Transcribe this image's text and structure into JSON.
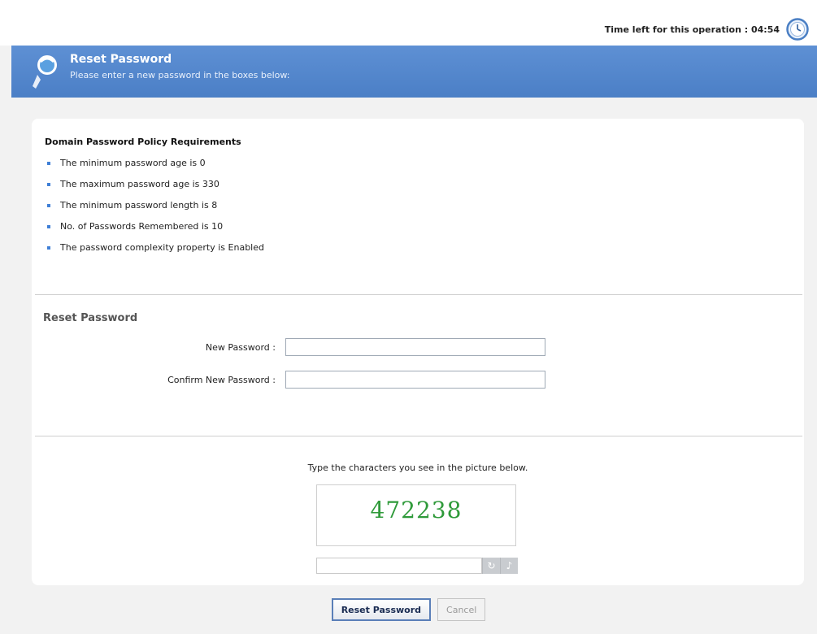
{
  "header": {
    "timer_label": "Time left for this operation :",
    "timer_value": "04:54"
  },
  "banner": {
    "title": "Reset Password",
    "subtitle": "Please enter a new password in the boxes below:"
  },
  "policy": {
    "title": "Domain Password Policy Requirements",
    "items": [
      "The minimum password age is 0",
      "The maximum password age is 330",
      "The minimum password length is 8",
      "No. of Passwords Remembered is 10",
      "The password complexity property is Enabled"
    ]
  },
  "reset_form": {
    "section_title": "Reset Password",
    "new_password_label": "New Password :",
    "new_password_value": "",
    "confirm_password_label": "Confirm New Password :",
    "confirm_password_value": ""
  },
  "captcha": {
    "prompt": "Type the characters you see in the picture below.",
    "image_text": "472238",
    "input_value": ""
  },
  "buttons": {
    "reset_label": "Reset Password",
    "cancel_label": "Cancel"
  },
  "colors": {
    "banner": "#5e90d4",
    "bullet": "#3f7fd6",
    "captcha_text": "#2f9a3a"
  },
  "icons": {
    "timer": "clock-icon",
    "banner": "key-icon",
    "captcha_refresh": "refresh-icon",
    "captcha_audio": "speaker-icon"
  }
}
